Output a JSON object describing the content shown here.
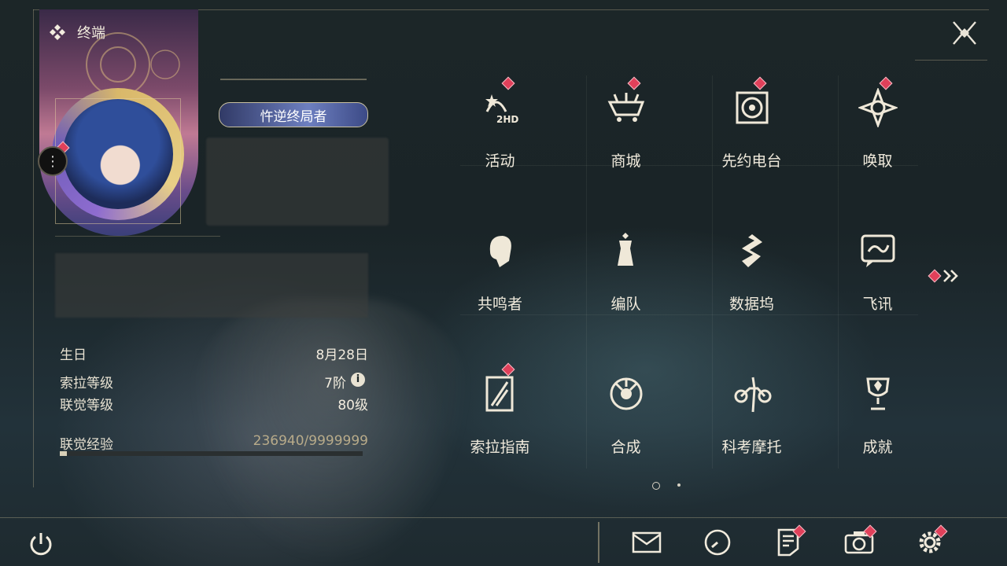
{
  "profile": {
    "section_title": "终端",
    "player_title": "忤逆终局者",
    "stats": [
      {
        "label": "生日",
        "value": "8月28日"
      },
      {
        "label": "索拉等级",
        "value": "7阶"
      },
      {
        "label": "联觉等级",
        "value": "80级"
      }
    ],
    "exp_label": "联觉经验",
    "exp_value": "236940/9999999",
    "exp_progress": 0.024
  },
  "menu": {
    "items": [
      {
        "label": "活动",
        "icon": "event-icon",
        "badge": true
      },
      {
        "label": "商城",
        "icon": "shop-icon",
        "badge": true
      },
      {
        "label": "先约电台",
        "icon": "radio-icon",
        "badge": true
      },
      {
        "label": "唤取",
        "icon": "summon-icon",
        "badge": true
      },
      {
        "label": "共鸣者",
        "icon": "resonator-icon",
        "badge": false
      },
      {
        "label": "编队",
        "icon": "team-icon",
        "badge": false
      },
      {
        "label": "数据坞",
        "icon": "data-bank-icon",
        "badge": false
      },
      {
        "label": "飞讯",
        "icon": "message-icon",
        "badge": false
      },
      {
        "label": "索拉指南",
        "icon": "guide-icon",
        "badge": true
      },
      {
        "label": "合成",
        "icon": "synthesis-icon",
        "badge": false
      },
      {
        "label": "科考摩托",
        "icon": "motorcycle-icon",
        "badge": false
      },
      {
        "label": "成就",
        "icon": "achievement-icon",
        "badge": false
      }
    ],
    "page_count": 2,
    "current_page": 1
  },
  "bottom_bar": [
    "power-icon",
    "mail-icon",
    "clock-icon",
    "notes-icon",
    "camera-icon",
    "settings-icon"
  ],
  "colors": {
    "accent": "#d9b86a",
    "badge": "#e0405a",
    "text": "#ece6d6"
  }
}
